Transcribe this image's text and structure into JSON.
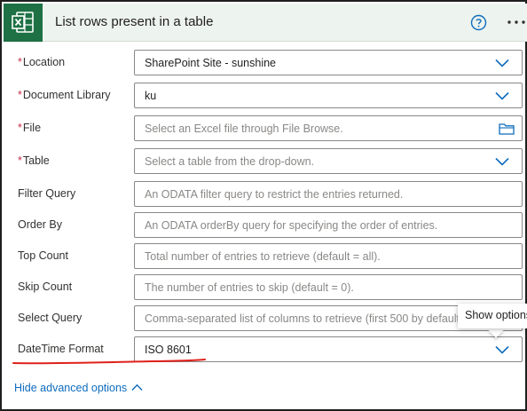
{
  "header": {
    "title": "List rows present in a table",
    "logo_icon": "excel-icon",
    "help_icon": "help-circle-icon",
    "more_icon": "more-horizontal-icon",
    "bg_color": "#edf3ee",
    "logo_color": "#1e7145"
  },
  "fields": {
    "location": {
      "required_mark": "*",
      "label": "Location",
      "value": "SharePoint Site - sunshine"
    },
    "document_library": {
      "required_mark": "*",
      "label": "Document Library",
      "value": "ku"
    },
    "file": {
      "required_mark": "*",
      "label": "File",
      "placeholder": "Select an Excel file through File Browse."
    },
    "table": {
      "required_mark": "*",
      "label": "Table",
      "placeholder": "Select a table from the drop-down."
    },
    "filter_query": {
      "label": "Filter Query",
      "placeholder": "An ODATA filter query to restrict the entries returned."
    },
    "order_by": {
      "label": "Order By",
      "placeholder": "An ODATA orderBy query for specifying the order of entries."
    },
    "top_count": {
      "label": "Top Count",
      "placeholder": "Total number of entries to retrieve (default = all)."
    },
    "skip_count": {
      "label": "Skip Count",
      "placeholder": "The number of entries to skip (default = 0)."
    },
    "select_query": {
      "label": "Select Query",
      "placeholder": "Comma-separated list of columns to retrieve (first 500 by default)."
    },
    "datetime_format": {
      "label": "DateTime Format",
      "value": "ISO 8601"
    }
  },
  "tooltip": {
    "text": "Show options"
  },
  "footer": {
    "hide_advanced_label": "Hide advanced options"
  },
  "colors": {
    "required": "#c4314b",
    "link": "#0f6cbd",
    "chevron": "#0f6cbd",
    "annotation_underline": "#e0201b"
  }
}
